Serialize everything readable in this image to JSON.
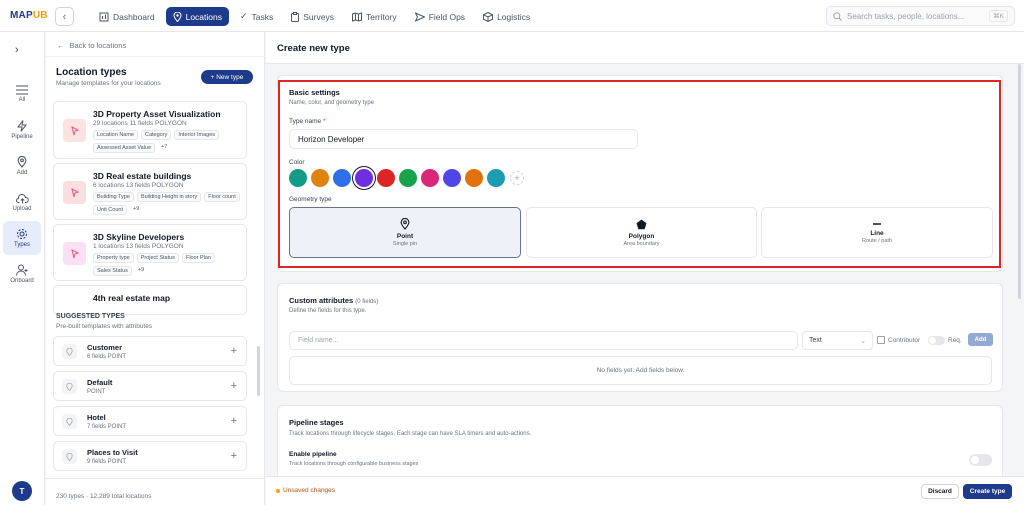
{
  "app": {
    "logo_main": "MAP",
    "logo_accent": "UB"
  },
  "nav": [
    {
      "label": "Dashboard",
      "icon": "dashboard-icon",
      "active": false
    },
    {
      "label": "Locations",
      "icon": "location-pin-icon",
      "active": true
    },
    {
      "label": "Tasks",
      "icon": "tasks-check-icon",
      "active": false
    },
    {
      "label": "Surveys",
      "icon": "clipboard-icon",
      "active": false
    },
    {
      "label": "Territory",
      "icon": "map-icon",
      "active": false
    },
    {
      "label": "Field Ops",
      "icon": "send-icon",
      "active": false
    },
    {
      "label": "Logistics",
      "icon": "package-icon",
      "active": false
    }
  ],
  "search": {
    "placeholder": "Search tasks, people, locations...",
    "shortcut": "⌘K"
  },
  "rail": [
    {
      "label": "All",
      "icon": "list-icon"
    },
    {
      "label": "Pipeline",
      "icon": "lightning-icon"
    },
    {
      "label": "Add",
      "icon": "location-pin-icon"
    },
    {
      "label": "Upload",
      "icon": "cloud-upload-icon"
    },
    {
      "label": "Types",
      "icon": "gear-icon"
    },
    {
      "label": "Onboard",
      "icon": "user-add-icon"
    }
  ],
  "user": {
    "initial": "T"
  },
  "sidebar": {
    "back": "Back to locations",
    "title": "Location types",
    "subtitle": "Manage templates for your locations",
    "new_button": "+  New type",
    "types": [
      {
        "name": "3D Property Asset Visualization",
        "meta": "29 locations   11 fields   POLYGON",
        "icon_bg": "#fde2e2",
        "tags": [
          "Location Name",
          "Category",
          "Interior Images",
          "Assessed Asset Value"
        ],
        "more": "+7"
      },
      {
        "name": "3D Real estate buildings",
        "meta": "6 locations   13 fields   POLYGON",
        "icon_bg": "#f7e0de",
        "tags": [
          "Building Type",
          "Building Height in story",
          "Floor count",
          "Unit Count"
        ],
        "more": "+9"
      },
      {
        "name": "3D Skyline Developers",
        "meta": "1 locations   13 fields   POLYGON",
        "icon_bg": "#fbe0f3",
        "tags": [
          "Property type",
          "Project Status",
          "Floor Plan",
          "Sales Status"
        ],
        "more": "+9"
      },
      {
        "name": "4th real estate map"
      }
    ],
    "suggested_title": "SUGGESTED TYPES",
    "suggested_subtitle": "Pre-built templates with attributes",
    "suggested": [
      {
        "name": "Customer",
        "meta": "6 fields   POINT"
      },
      {
        "name": "Default",
        "meta": "POINT"
      },
      {
        "name": "Hotel",
        "meta": "7 fields   POINT"
      },
      {
        "name": "Places to Visit",
        "meta": "9 fields   POINT"
      }
    ],
    "footer": "230 types · 12,289 total locations"
  },
  "main": {
    "title": "Create new type",
    "basic": {
      "title": "Basic settings",
      "subtitle": "Name, color, and geometry type",
      "name_label": "Type name",
      "name_req": "*",
      "name_value": "Horizon Developer",
      "color_label": "Color",
      "colors": [
        "#139b86",
        "#e0820c",
        "#2f6fe8",
        "#6d2fe0",
        "#dc2626",
        "#16a34a",
        "#db2777",
        "#4f46e5",
        "#e0710c",
        "#1b9cb0"
      ],
      "selected_color": "#6d2fe0",
      "geometry_label": "Geometry type",
      "geometry": [
        {
          "name": "Point",
          "desc": "Single pin",
          "icon": "location-pin-icon",
          "selected": true
        },
        {
          "name": "Polygon",
          "desc": "Area boundary",
          "icon": "pentagon-icon",
          "selected": false
        },
        {
          "name": "Line",
          "desc": "Route / path",
          "icon": "line-icon",
          "selected": false
        }
      ]
    },
    "custom": {
      "title": "Custom attributes",
      "count": "(0 fields)",
      "subtitle": "Define the fields for this type.",
      "field_placeholder": "Field name...",
      "type_value": "Text",
      "contributor": "Contributor",
      "req": "Req.",
      "add": "Add",
      "empty": "No fields yet. Add fields below."
    },
    "pipeline": {
      "title": "Pipeline stages",
      "subtitle": "Track locations through lifecycle stages. Each stage can have SLA timers and auto-actions.",
      "enable_label": "Enable pipeline",
      "enable_desc": "Track locations through configurable business stages"
    },
    "footer": {
      "unsaved": "Unsaved changes",
      "discard": "Discard",
      "create": "Create type"
    }
  }
}
